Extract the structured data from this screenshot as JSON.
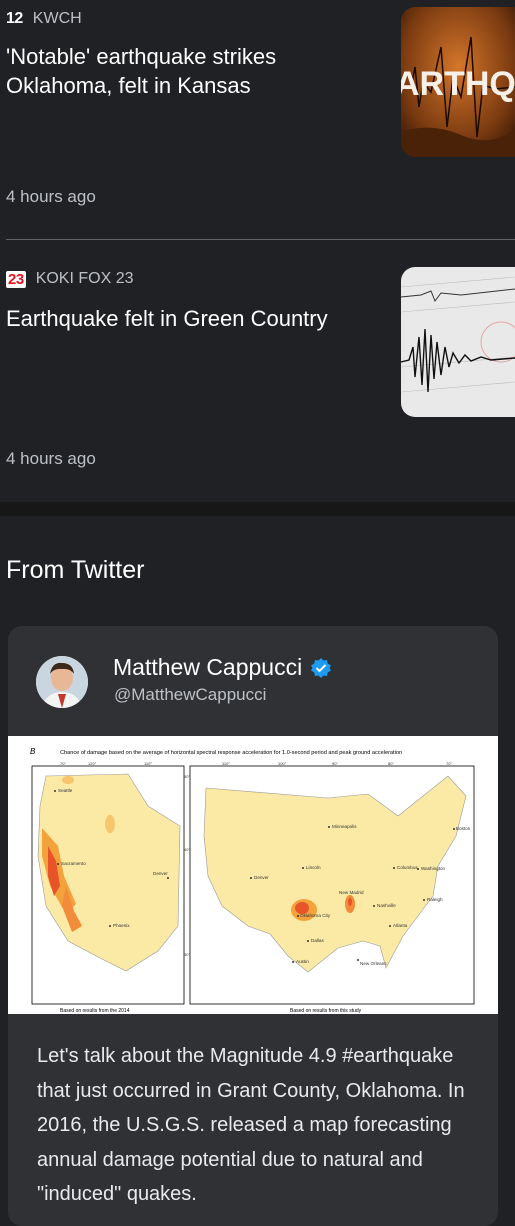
{
  "articles": [
    {
      "source_logo": "12",
      "source": "KWCH",
      "headline": "'Notable' earthquake strikes Oklahoma, felt in Kansas",
      "time": "4 hours ago",
      "thumb_text": "ARTHQU"
    },
    {
      "source_logo": "23",
      "source": "KOKI FOX 23",
      "headline": "Earthquake felt in Green Country",
      "time": "4 hours ago"
    }
  ],
  "twitter": {
    "section_title": "From Twitter",
    "author": "Matthew Cappucci",
    "handle": "@MatthewCappucci",
    "verified_icon": "verified-badge-icon",
    "text": "Let's talk about the Magnitude 4.9 #earthquake that just occurred in Grant County, Oklahoma. In 2016, the U.S.G.S. released a map forecasting annual damage potential due to natural and \"induced\" quakes.",
    "image": {
      "panel_letter": "B",
      "caption": "Chance of damage based on the average of horizontal spectral response acceleration for 1.0-second period and peak ground acceleration",
      "left_footer": "Based on results from the 2014",
      "right_footer": "Based on results from this study",
      "left_cities": [
        "Seattle",
        "Sacramento",
        "Denver",
        "Phoenix"
      ],
      "right_cities": [
        "Minneapolis",
        "Boston",
        "Lincoln",
        "Columbus",
        "Washington",
        "Denver",
        "New Madrid",
        "Nashville",
        "Raleigh",
        "Oklahoma City",
        "Atlanta",
        "Dallas",
        "Austin",
        "New Orleans"
      ],
      "left_ticks": [
        "70°",
        "120°",
        "110°"
      ],
      "right_ticks": [
        "110°",
        "100°",
        "90°",
        "80°",
        "70°"
      ],
      "lat_ticks": [
        "50°",
        "40°",
        "30°"
      ]
    }
  }
}
